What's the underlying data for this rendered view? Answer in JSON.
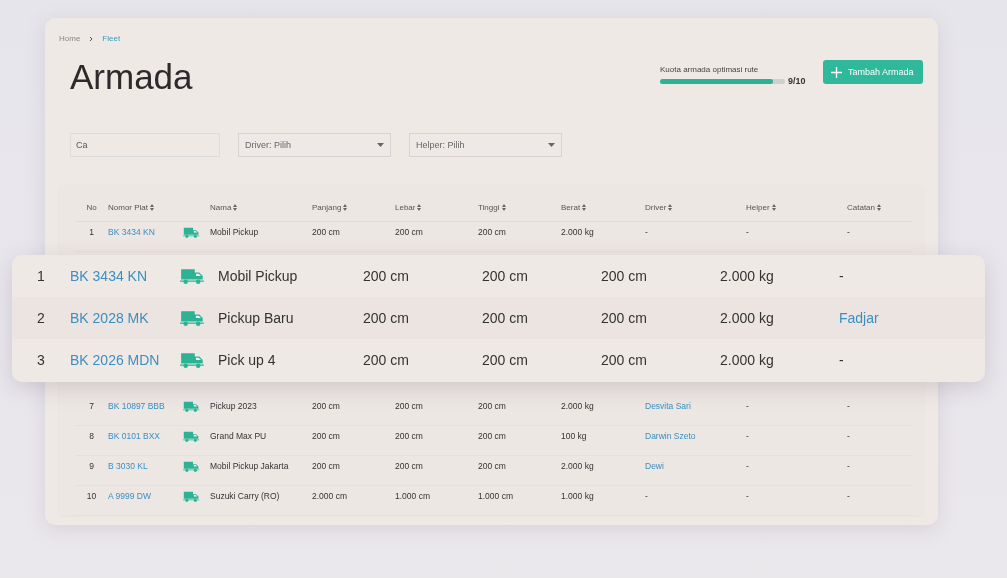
{
  "breadcrumb": [
    {
      "label": "Home",
      "current": false
    },
    {
      "label": "Fleet",
      "current": true
    }
  ],
  "title": "Armada",
  "quota": {
    "label": "Kuota armada optimasi rute",
    "level": 0.9,
    "reading": "9/10"
  },
  "add_button": {
    "label": "Tambah Armada"
  },
  "filters": {
    "search": {
      "value": "Ca"
    },
    "selects": [
      {
        "label": "Driver: Pilih"
      },
      {
        "label": "Helper: Pilih"
      }
    ]
  },
  "table": {
    "columns": [
      {
        "label": "No",
        "sortable": false
      },
      {
        "label": "Nomor Plat",
        "sortable": true
      },
      {
        "label": "Nama",
        "sortable": true
      },
      {
        "label": "Panjang",
        "sortable": true
      },
      {
        "label": "Lebar",
        "sortable": true
      },
      {
        "label": "Tinggi",
        "sortable": true
      },
      {
        "label": "Berat",
        "sortable": true
      },
      {
        "label": "Driver",
        "sortable": true
      },
      {
        "label": "Helper",
        "sortable": true
      },
      {
        "label": "Catatan",
        "sortable": true
      }
    ],
    "rows_top": [
      {
        "no": "1",
        "plate": "BK 3434 KN",
        "name": "Mobil Pickup",
        "panjang": "200 cm",
        "lebar": "200 cm",
        "tinggi": "200 cm",
        "berat": "2.000 kg",
        "driver": {
          "text": "-",
          "link": false
        },
        "helper": "-",
        "catatan": "-"
      }
    ],
    "rows_bottom": [
      {
        "no": "7",
        "plate": "BK 10897 BBB",
        "name": "Pickup 2023",
        "panjang": "200 cm",
        "lebar": "200 cm",
        "tinggi": "200 cm",
        "berat": "2.000 kg",
        "driver": {
          "text": "Desvita Sari",
          "link": true
        },
        "helper": "-",
        "catatan": "-"
      },
      {
        "no": "8",
        "plate": "BK 0101 BXX",
        "name": "Grand Max PU",
        "panjang": "200 cm",
        "lebar": "200 cm",
        "tinggi": "200 cm",
        "berat": "100 kg",
        "driver": {
          "text": "Darwin Szeto",
          "link": true
        },
        "helper": "-",
        "catatan": "-"
      },
      {
        "no": "9",
        "plate": "B 3030 KL",
        "name": "Mobil Pickup Jakarta",
        "panjang": "200 cm",
        "lebar": "200 cm",
        "tinggi": "200 cm",
        "berat": "2.000 kg",
        "driver": {
          "text": "Dewi",
          "link": true
        },
        "helper": "-",
        "catatan": "-"
      },
      {
        "no": "10",
        "plate": "A 9999 DW",
        "name": "Suzuki Carry (RO)",
        "panjang": "2.000 cm",
        "lebar": "1.000 cm",
        "tinggi": "1.000 cm",
        "berat": "1.000 kg",
        "driver": {
          "text": "-",
          "link": false
        },
        "helper": "-",
        "catatan": "-"
      }
    ]
  },
  "highlight": {
    "rows": [
      {
        "no": "1",
        "plate": "BK 3434 KN",
        "name": "Mobil Pickup",
        "panjang": "200 cm",
        "lebar": "200 cm",
        "tinggi": "200 cm",
        "berat": "2.000 kg",
        "driver": {
          "text": "-",
          "link": false
        }
      },
      {
        "no": "2",
        "plate": "BK 2028 MK",
        "name": "Pickup Baru",
        "panjang": "200 cm",
        "lebar": "200 cm",
        "tinggi": "200 cm",
        "berat": "2.000 kg",
        "driver": {
          "text": "Fadjar",
          "link": true
        }
      },
      {
        "no": "3",
        "plate": "BK 2026 MDN",
        "name": "Pick up 4",
        "panjang": "200 cm",
        "lebar": "200 cm",
        "tinggi": "200 cm",
        "berat": "2.000 kg",
        "driver": {
          "text": "-",
          "link": false
        }
      }
    ]
  }
}
